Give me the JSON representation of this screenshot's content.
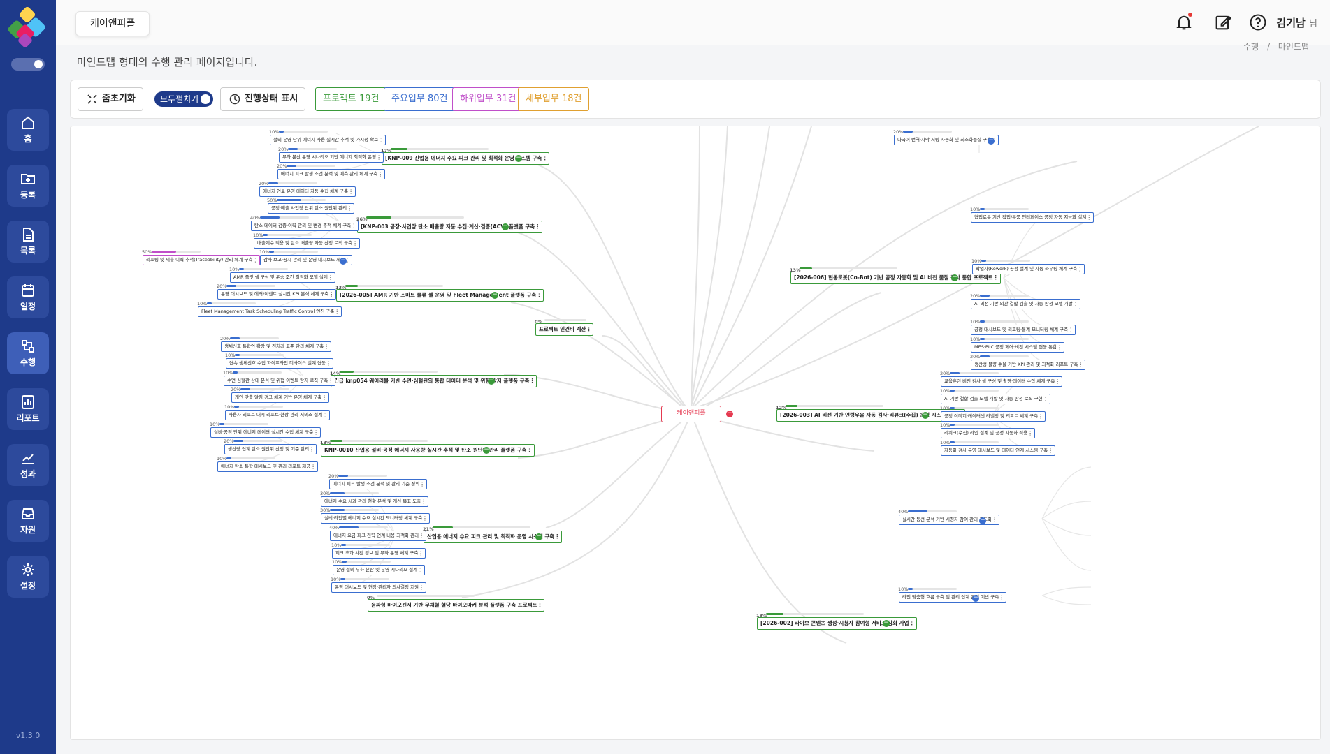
{
  "org": {
    "name": "케이앤피플"
  },
  "user": {
    "name": "김기남",
    "suffix": "님"
  },
  "breadcrumb": {
    "parent": "수행",
    "sep": "/",
    "current": "마인드맵"
  },
  "page_desc": "마인드맵 형태의 수행 관리 페이지입니다.",
  "sidebar": {
    "items": [
      {
        "label": "홈",
        "icon": "home-icon"
      },
      {
        "label": "등록",
        "icon": "folder-plus-icon"
      },
      {
        "label": "목록",
        "icon": "document-icon"
      },
      {
        "label": "일정",
        "icon": "calendar-icon"
      },
      {
        "label": "수행",
        "icon": "flow-icon"
      },
      {
        "label": "리포트",
        "icon": "report-icon"
      },
      {
        "label": "성과",
        "icon": "chart-line-icon"
      },
      {
        "label": "자원",
        "icon": "inbox-icon"
      },
      {
        "label": "설정",
        "icon": "gear-icon"
      }
    ],
    "active": "수행",
    "version": "v1.3.0"
  },
  "toolbar": {
    "zoom_reset": "줌초기화",
    "expand_all": "모두펼치기",
    "status_display": "진행상태 표시",
    "counts": [
      {
        "label": "프로젝트 19건",
        "color": "#3a9a3a"
      },
      {
        "label": "주요업무 80건",
        "color": "#3a6ecf"
      },
      {
        "label": "하위업무 31건",
        "color": "#c04fc9"
      },
      {
        "label": "세부업무 18건",
        "color": "#e0a030"
      }
    ]
  },
  "colors": {
    "primary": "#1e3a8a",
    "project": "#3a9a3a",
    "task": "#3a6ecf",
    "subtask": "#c04fc9",
    "detail": "#e0a030",
    "root": "#e53950"
  },
  "mindmap": {
    "root": "케이앤피플",
    "projects": [
      {
        "label": "[KNP-009 산업용 에너지 수요 피크 관리 및 최적화 운영 시스템 구축",
        "pct": "17%"
      },
      {
        "label": "[KNP-003 공장·사업장 탄소 배출량 자동 수집·계산·검증(ACV) 플랫폼 구축",
        "pct": "26%"
      },
      {
        "label": "[2026-005] AMR 기반 스마트 물류 셀 운영 및 Fleet Management 플랫폼 구축",
        "pct": "13%"
      },
      {
        "label": "프로젝트 인건비 계산",
        "pct": "0%"
      },
      {
        "label": "긴급 knp054 웨어러블 기반 수면·심혈관의 통합 데이터 분석 및 위험 방지 플랫폼 구축",
        "pct": "14%"
      },
      {
        "label": "KNP-0010 산업용 설비·공정 에너지 사용량 실시간 추적 및 탄소 원단위 관리 플랫폼 구축",
        "pct": "13%"
      },
      {
        "label": "산업용 에너지 수요 피크 관리 및 최적화 운영 시스템 구축",
        "pct": "21%"
      },
      {
        "label": "음파형 바이오센서 기반 무채혈 혈당 바이오마커 분석 플랫폼 구축 프로젝트",
        "pct": "0%"
      },
      {
        "label": "[2026-006] 협동로봇(Co-Bot) 기반 공정 자동화 및 AI 비전 품질 검사 통합 프로젝트",
        "pct": "13%"
      },
      {
        "label": "[2026-003] AI 비전 기반 연령우울 자동 검사·리뷰크(수집) 운영 시스템 구축",
        "pct": "12%"
      },
      {
        "label": "[2026-002] 라이브 콘텐츠 생성·시청자 참여형 서비스 강화 사업",
        "pct": "18%"
      }
    ],
    "tasks_left_1": [
      {
        "label": "설비 운영 단위 에너지 사용 실시간 추적 및 가시성 확보",
        "pct": "10%"
      },
      {
        "label": "부하 분산 운영 시나리오 기반 에너지 최적화 운영",
        "pct": "20%"
      },
      {
        "label": "에너지 피크 발생 조건 분석 및 예측 관리 체계 구축",
        "pct": "20%"
      }
    ],
    "tasks_left_2": [
      {
        "label": "에너지 연료·운영 데이터 자동 수집 체계 구축",
        "pct": "20%"
      },
      {
        "label": "공정·배출 사업장 단위 탄소 원단위 관리",
        "pct": "50%"
      },
      {
        "label": "탄소 데이터 검증·이력 관리 및 변경 추적 체계 구축",
        "pct": "40%"
      },
      {
        "label": "배출계수 적용 및 탄소 배출량 자동 산정 로직 구축",
        "pct": "10%"
      },
      {
        "label": "감사 보고·공시 관리 및 운영 대시보드 제공",
        "pct": "10%"
      }
    ],
    "trace_node": {
      "label": "리포팅 및 제출 이력 추적(Traceability) 관리 체계 구축",
      "pct": "50%"
    },
    "tasks_left_3": [
      {
        "label": "AMR 플릿 셀 구성 및 운송 조건 최적화 모델 설계",
        "pct": "10%"
      },
      {
        "label": "운영 대시보드 및 에러/이벤트 실시간 KPI 분석 체계 구축",
        "pct": "20%"
      },
      {
        "label": "Fleet Management·Task Scheduling·Traffic Control 엔진 구축",
        "pct": "10%"
      }
    ],
    "tasks_left_4": [
      {
        "label": "생체신호 통합연 확장 및 전처리·표준 관리 체계 구축",
        "pct": "20%"
      },
      {
        "label": "연속 생체신호 수집 파이프라인 디바이스 설계 연동",
        "pct": "10%"
      },
      {
        "label": "수면·심혈관 상태 분석 및 위험 이벤트 탐지 로직 구축",
        "pct": "10%"
      },
      {
        "label": "개인 맞춤 알림·경고 체계 기반 운영 체계 구축",
        "pct": "20%"
      },
      {
        "label": "사용자 리포트 대시 리포트·현장 관리 서비스 설계",
        "pct": "10%"
      }
    ],
    "tasks_left_5": [
      {
        "label": "설비·공정 단위 에너지 데이터 실시간 수집 체계 구축",
        "pct": "10%"
      },
      {
        "label": "생산량 연계 탄소 원단위 산정 및 기준 관리",
        "pct": "20%"
      },
      {
        "label": "에너지·탄소 통합 대시보드 및 관리 리포트 제공",
        "pct": "10%"
      }
    ],
    "tasks_left_6": [
      {
        "label": "에너지 피크 발생 조건 분석 및 관리 기준 정의",
        "pct": "20%"
      },
      {
        "label": "에너지 수요 시과 관리 현황 분석 및 개선 목표 도출",
        "pct": "30%"
      },
      {
        "label": "설비·라인별 에너지 수요 실시간 모니터링 체계 구축",
        "pct": "30%"
      },
      {
        "label": "에너지 요금·피크 전력 연계 비용 최적화 관리",
        "pct": "40%"
      },
      {
        "label": "피크 초과 사전 경보 및 부하 운영 체계 구축",
        "pct": "10%"
      },
      {
        "label": "운영 설비 부하 분산 및 운영 시나리오 설계",
        "pct": "10%"
      },
      {
        "label": "운영 대시보드 및 현장·관리자 의사결정 지원",
        "pct": "10%"
      }
    ],
    "tasks_right_1": [
      {
        "label": "다국어 번역·자막 서빙 자동화 및 최소화품질 구축",
        "pct": "20%"
      }
    ],
    "tasks_right_2": [
      {
        "label": "협업로봇 기반 작업/부품 인터페이스 공정 자동 지능화 설계",
        "pct": "10%"
      },
      {
        "label": "작업자(Rework) 공정 설계 및 자동 라우팅 체계 구축",
        "pct": "10%"
      },
      {
        "label": "AI 비전 기반 외관 결함 검출 및 자동 판정 모델 개발",
        "pct": "20%"
      },
      {
        "label": "공정 대시보드 및 리포팅·통계 모니터링 체계 구축",
        "pct": "10%"
      },
      {
        "label": "MES·PLC 공정 제어·비전 시스템 연동 통합",
        "pct": "10%"
      },
      {
        "label": "생산성·불량 수율 기반 KPI 관리 및 최적화 리포트 구축",
        "pct": "20%"
      }
    ],
    "tasks_right_3": [
      {
        "label": "교육훈련 비전 검사 셀 구성 및 촬영·데이터 수집 체계 구축",
        "pct": "20%"
      },
      {
        "label": "AI 기반 결함 검출 모델 개발 및 자동 판정 로직 구현",
        "pct": "10%"
      },
      {
        "label": "공정 이미지·데이터셋 라벨링 및 리포트 체계 구축",
        "pct": "10%"
      },
      {
        "label": "리워크(수집) 라인 설계 및 공정 자동화 적용",
        "pct": "10%"
      },
      {
        "label": "자동화 검사 운영 대시보드 및 데이터 연계 시스템 구축",
        "pct": "10%"
      }
    ],
    "tasks_right_4": [
      {
        "label": "실시간 동선 분석 기반 시청자 참여 관리 고도화",
        "pct": "40%"
      },
      {
        "label": "라인 맞춤형 흐름 구축 및 관리 연계 운영 기반 구축",
        "pct": "10%"
      }
    ]
  }
}
